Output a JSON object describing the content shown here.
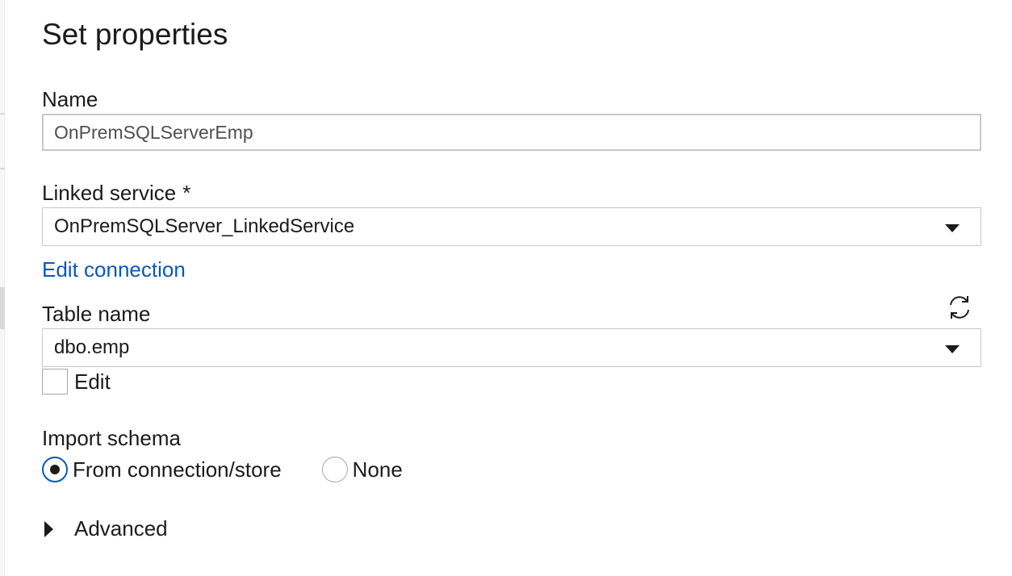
{
  "panel": {
    "title": "Set properties"
  },
  "name_field": {
    "label": "Name",
    "value": "OnPremSQLServerEmp"
  },
  "linked_service": {
    "label": "Linked service",
    "required_marker": "*",
    "selected": "OnPremSQLServer_LinkedService",
    "edit_link": "Edit connection"
  },
  "table_name": {
    "label": "Table name",
    "selected": "dbo.emp",
    "refresh_icon": "refresh-icon",
    "edit_checkbox_label": "Edit",
    "edit_checked": false
  },
  "import_schema": {
    "label": "Import schema",
    "options": [
      {
        "label": "From connection/store",
        "selected": true
      },
      {
        "label": "None",
        "selected": false
      }
    ]
  },
  "advanced": {
    "label": "Advanced",
    "expanded": false
  },
  "colors": {
    "link": "#0a58b5",
    "text": "#1b1b1b",
    "border": "#c8c8c8"
  }
}
